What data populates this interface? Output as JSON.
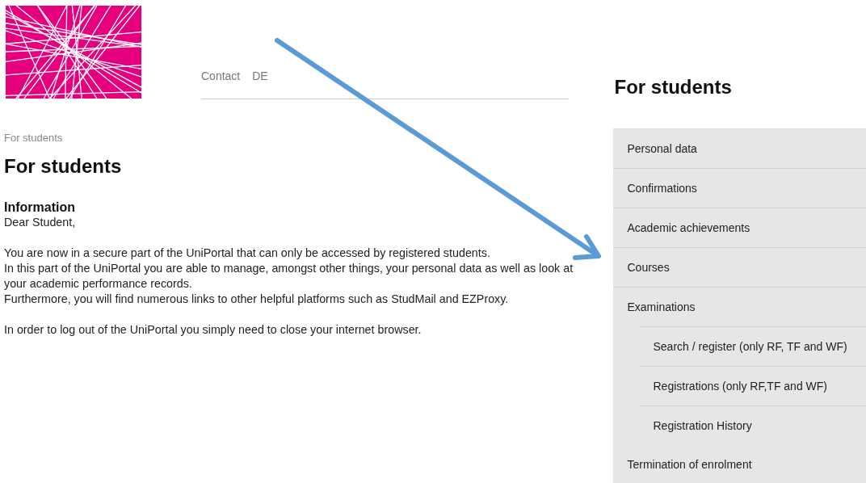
{
  "nav": {
    "links": [
      "Contact",
      "DE"
    ]
  },
  "breadcrumb": "For students",
  "title": "For students",
  "information": {
    "heading": "Information",
    "greeting": "Dear Student,",
    "blocks": [
      [
        "You are now in a secure part of the UniPortal that can only be accessed by registered students.",
        "In this part of the UniPortal you are able to manage, amongst other things, your personal data as well as look at your academic performance records.",
        "Furthermore, you will find numerous links to other helpful platforms such as StudMail and EZProxy."
      ],
      [
        "In order to log out of the UniPortal you simply need to close your internet browser."
      ]
    ]
  },
  "sidebar": {
    "title": "For students",
    "items": [
      {
        "label": "Personal data"
      },
      {
        "label": "Confirmations"
      },
      {
        "label": "Academic achievements"
      },
      {
        "label": "Courses"
      },
      {
        "label": "Examinations",
        "children": [
          {
            "label": "Search / register (only RF, TF and WF)"
          },
          {
            "label": "Registrations (only RF,TF and WF)"
          },
          {
            "label": "Registration History"
          }
        ]
      },
      {
        "label": "Termination of enrolment"
      }
    ]
  }
}
